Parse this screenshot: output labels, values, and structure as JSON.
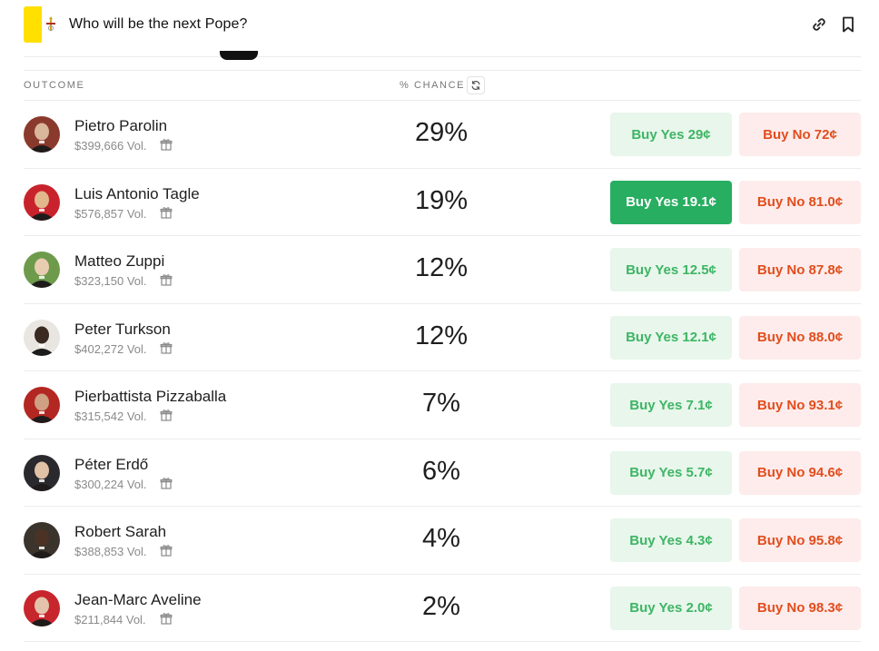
{
  "header": {
    "title": "Who will be the next Pope?",
    "flag_colors": [
      "#ffe000",
      "#ffffff"
    ],
    "icons": [
      "link-icon",
      "bookmark-icon"
    ]
  },
  "table": {
    "col_outcome": "OUTCOME",
    "col_chance": "% CHANCE",
    "refresh_icon": "refresh-icon",
    "rows": [
      {
        "name": "Pietro Parolin",
        "volume": "$399,666 Vol.",
        "chance": "29%",
        "buy_yes": "Buy Yes 29¢",
        "buy_no": "Buy No 72¢",
        "yes_active": false,
        "avatar_bg": "#8a3a2c",
        "avatar_fg": "#d9b69a"
      },
      {
        "name": "Luis Antonio Tagle",
        "volume": "$576,857 Vol.",
        "chance": "19%",
        "buy_yes": "Buy Yes 19.1¢",
        "buy_no": "Buy No 81.0¢",
        "yes_active": true,
        "avatar_bg": "#c8232c",
        "avatar_fg": "#e2b78c"
      },
      {
        "name": "Matteo Zuppi",
        "volume": "$323,150 Vol.",
        "chance": "12%",
        "buy_yes": "Buy Yes 12.5¢",
        "buy_no": "Buy No 87.8¢",
        "yes_active": false,
        "avatar_bg": "#6e9a4c",
        "avatar_fg": "#e8cdb0"
      },
      {
        "name": "Peter Turkson",
        "volume": "$402,272 Vol.",
        "chance": "12%",
        "buy_yes": "Buy Yes 12.1¢",
        "buy_no": "Buy No 88.0¢",
        "yes_active": false,
        "avatar_bg": "#e9e6e1",
        "avatar_fg": "#3a2a22"
      },
      {
        "name": "Pierbattista Pizzaballa",
        "volume": "$315,542 Vol.",
        "chance": "7%",
        "buy_yes": "Buy Yes 7.1¢",
        "buy_no": "Buy No 93.1¢",
        "yes_active": false,
        "avatar_bg": "#b32722",
        "avatar_fg": "#cfa083"
      },
      {
        "name": "Péter Erdő",
        "volume": "$300,224 Vol.",
        "chance": "6%",
        "buy_yes": "Buy Yes 5.7¢",
        "buy_no": "Buy No 94.6¢",
        "yes_active": false,
        "avatar_bg": "#2a2a2e",
        "avatar_fg": "#e0c2a6"
      },
      {
        "name": "Robert Sarah",
        "volume": "$388,853 Vol.",
        "chance": "4%",
        "buy_yes": "Buy Yes 4.3¢",
        "buy_no": "Buy No 95.8¢",
        "yes_active": false,
        "avatar_bg": "#3b342c",
        "avatar_fg": "#4a3325"
      },
      {
        "name": "Jean-Marc Aveline",
        "volume": "$211,844 Vol.",
        "chance": "2%",
        "buy_yes": "Buy Yes 2.0¢",
        "buy_no": "Buy No 98.3¢",
        "yes_active": false,
        "avatar_bg": "#c7262c",
        "avatar_fg": "#e4c3ac"
      }
    ]
  },
  "colors": {
    "yes_bg": "#e8f6ec",
    "yes_text": "#3eb564",
    "yes_active_bg": "#27ae60",
    "no_bg": "#fdeceb",
    "no_text": "#e24d1d"
  }
}
